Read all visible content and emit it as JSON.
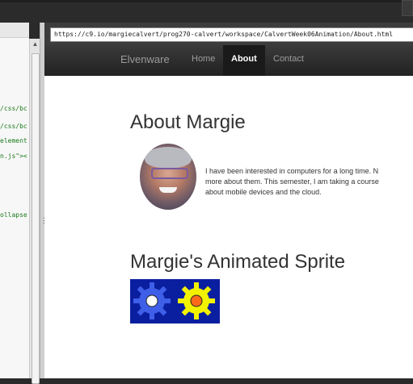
{
  "browser": {
    "url": "https://c9.io/margiecalvert/prog270-calvert/workspace/CalvertWeek06Animation/About.html"
  },
  "editor": {
    "code_fragments": [
      "/css/bc",
      "/css/bc",
      "element",
      "n.js\"><",
      "ollapse"
    ]
  },
  "navbar": {
    "brand": "Elvenware",
    "links": [
      "Home",
      "About",
      "Contact"
    ],
    "active": "About"
  },
  "page": {
    "heading_about": "About Margie",
    "bio_lines": [
      "I have been interested in computers for a long time. N",
      "more about them. This semester, I am taking a course",
      "about mobile devices and the cloud."
    ],
    "heading_sprite": "Margie's Animated Sprite"
  },
  "colors": {
    "navbar_bg": "#2a2a2a",
    "sprite_bg": "#0a1fa0",
    "gear_left": "#3f5fe8",
    "gear_right": "#f2f200",
    "gear_right_center": "#ff6a1a"
  }
}
